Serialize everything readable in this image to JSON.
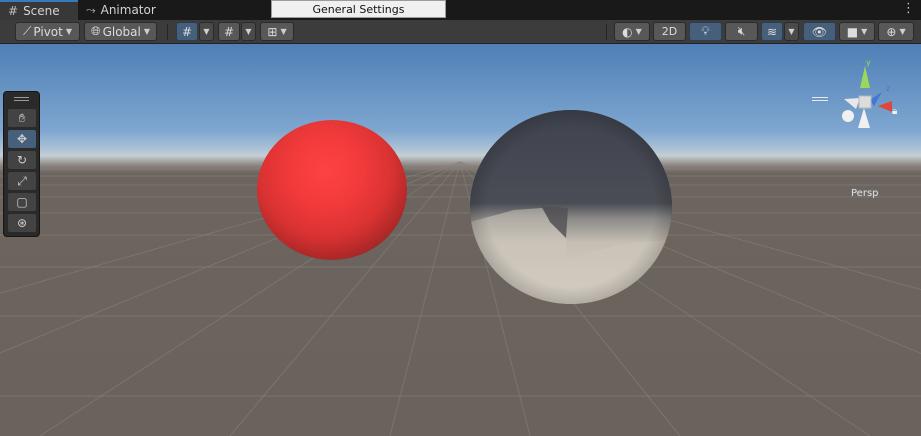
{
  "tabs": [
    {
      "icon": "grid-hash-icon",
      "label": "Scene",
      "active": true
    },
    {
      "icon": "animator-icon",
      "label": "Animator",
      "active": false
    }
  ],
  "popup": {
    "title": "General Settings"
  },
  "toolbar": {
    "pivot_label": "Pivot",
    "global_label": "Global",
    "two_d_label": "2D"
  },
  "tools": [
    "hand-tool",
    "move-tool",
    "rotate-tool",
    "scale-tool",
    "rect-tool",
    "transform-tool"
  ],
  "gizmo": {
    "axes": [
      "x",
      "y",
      "z"
    ],
    "projection_label": "Persp"
  },
  "colors": {
    "accent": "#3a79bb",
    "x_axis": "#e0463a",
    "y_axis": "#9bd75c",
    "z_axis": "#3f78d8",
    "red_sphere": "#f03838"
  }
}
